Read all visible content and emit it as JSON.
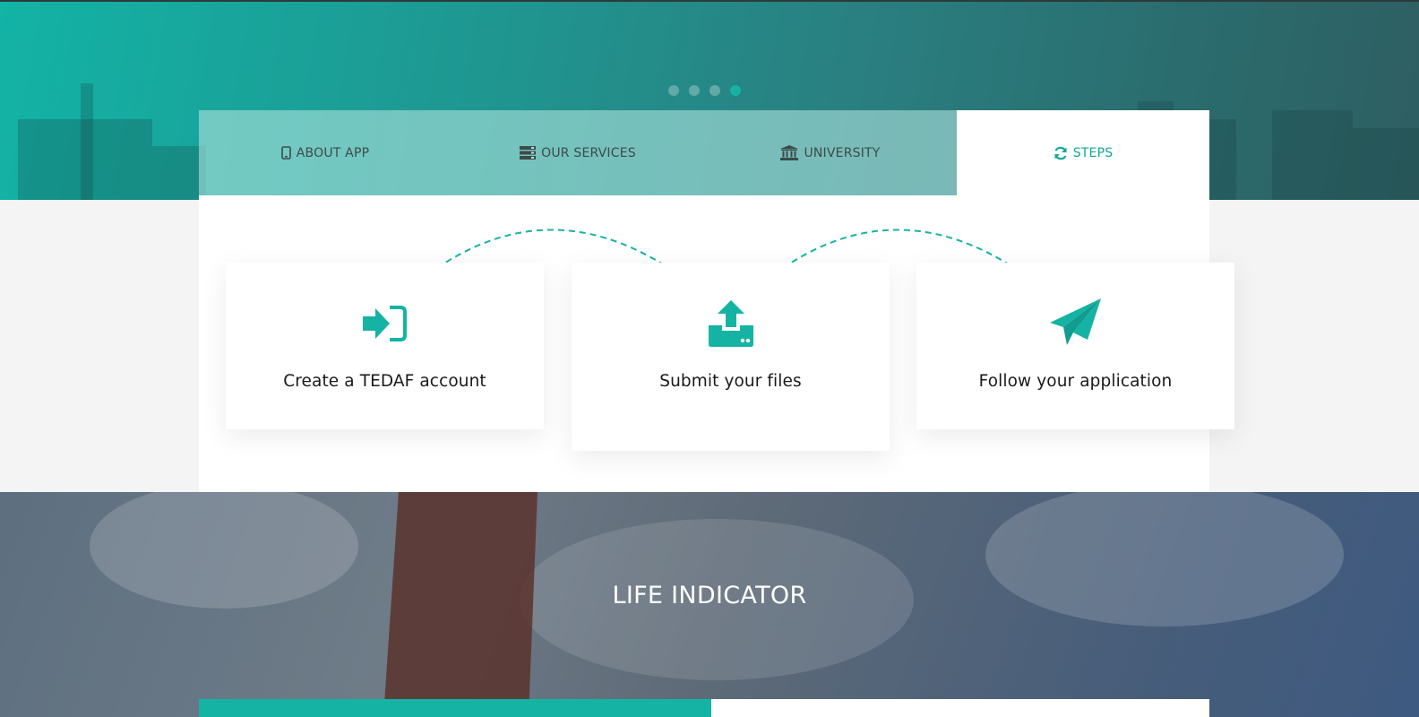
{
  "carousel": {
    "dots": 4,
    "active_index": 3
  },
  "tabs": [
    {
      "label": "ABOUT APP",
      "icon": "tablet-icon",
      "active": false
    },
    {
      "label": "OUR SERVICES",
      "icon": "server-icon",
      "active": false
    },
    {
      "label": "UNIVERSITY",
      "icon": "university-icon",
      "active": false
    },
    {
      "label": "STEPS",
      "icon": "refresh-icon",
      "active": true
    }
  ],
  "steps": [
    {
      "label": "Create a TEDAF account",
      "icon": "sign-in-icon"
    },
    {
      "label": "Submit your files",
      "icon": "upload-icon"
    },
    {
      "label": "Follow your application",
      "icon": "paper-plane-icon"
    }
  ],
  "section": {
    "title": "LIFE INDICATOR"
  },
  "colors": {
    "accent": "#15b3a3",
    "tab_inactive_text": "#3d4a4a",
    "panel": "#ffffff",
    "page_bg": "#f4f4f4"
  }
}
